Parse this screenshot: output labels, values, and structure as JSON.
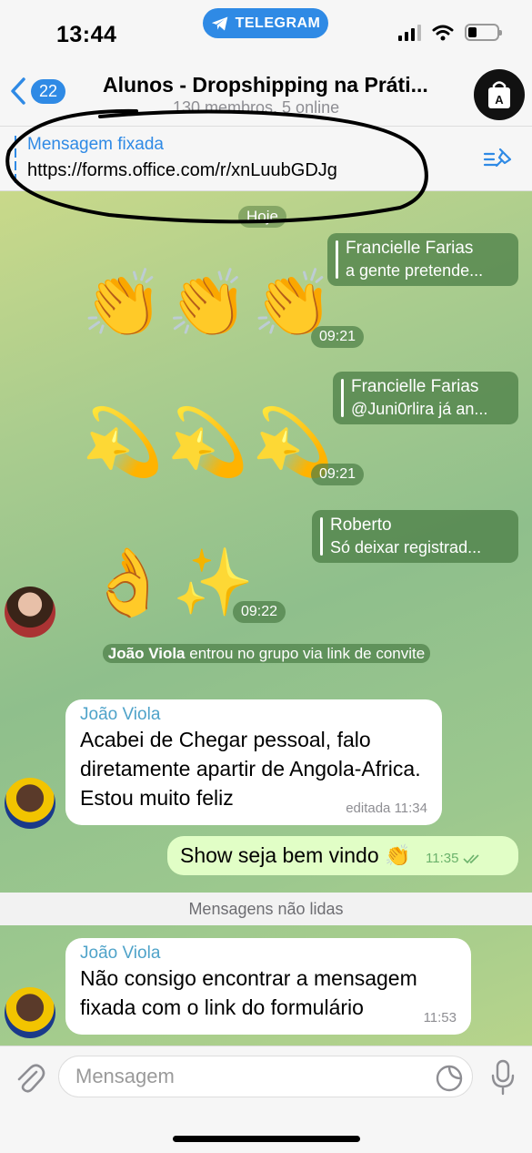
{
  "status_bar": {
    "time": "13:44",
    "app_pill": "TELEGRAM"
  },
  "header": {
    "back_count": "22",
    "title": "Alunos - Dropshipping na Práti...",
    "subtitle": "130 membros, 5 online"
  },
  "pinned": {
    "title": "Mensagem fixada",
    "text": "https://forms.office.com/r/xnLuubGDJg"
  },
  "chat": {
    "date": "Hoje",
    "messages": [
      {
        "reply_name": "Francielle Farias",
        "reply_text": "a gente pretende...",
        "emoji": "👏👏👏",
        "time": "09:21"
      },
      {
        "reply_name": "Francielle Farias",
        "reply_text": "@Juni0rlira já an...",
        "emoji": "💫💫💫",
        "time": "09:21"
      },
      {
        "reply_name": "Roberto",
        "reply_text": "Só deixar registrad...",
        "emoji": "👌✨",
        "time": "09:22"
      }
    ],
    "service": {
      "name": "João Viola",
      "text": "entrou no grupo via link de convite"
    },
    "incoming_1": {
      "name": "João Viola",
      "text": "Acabei de Chegar pessoal, falo diretamente apartir de Angola-Africa. Estou muito feliz",
      "meta": "editada 11:34"
    },
    "outgoing": {
      "text": "Show seja bem vindo 👏",
      "time": "11:35"
    },
    "unread_label": "Mensagens não lidas",
    "incoming_2": {
      "name": "João Viola",
      "text": "Não consigo encontrar a mensagem fixada com o link do formulário",
      "time": "11:53"
    }
  },
  "input": {
    "placeholder": "Mensagem"
  },
  "colors": {
    "accent": "#2f8ae5",
    "outgoing_bubble": "#e1fec6",
    "sender_name": "#4fa3c9"
  }
}
